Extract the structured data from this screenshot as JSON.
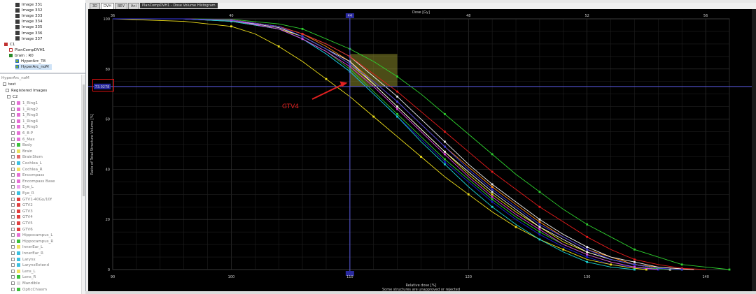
{
  "top_tree": [
    {
      "label": "Image 331",
      "icon": "image-icon",
      "indent": 22
    },
    {
      "label": "Image 332",
      "icon": "image-icon",
      "indent": 22
    },
    {
      "label": "Image 333",
      "icon": "image-icon",
      "indent": 22
    },
    {
      "label": "Image 334",
      "icon": "image-icon",
      "indent": 22
    },
    {
      "label": "Image 335",
      "icon": "image-icon",
      "indent": 22
    },
    {
      "label": "Image 336",
      "icon": "image-icon",
      "indent": 22
    },
    {
      "label": "Image 337",
      "icon": "image-icon",
      "indent": 22
    },
    {
      "label": "C1",
      "icon": "course-icon",
      "indent": 6
    },
    {
      "label": "PlanCompDVH1",
      "icon": "plan-sum-icon",
      "indent": 13
    },
    {
      "label": "brain : R0",
      "icon": "structure-set-icon",
      "indent": 13
    },
    {
      "label": "HyperArc_T8",
      "icon": "plan-icon",
      "indent": 22
    },
    {
      "label": "HyperArc_noM",
      "icon": "plan-icon",
      "indent": 22
    }
  ],
  "struct_header": {
    "title": "HyperArc_noM",
    "patient": "test",
    "registered": "Registered Images",
    "course": "C2"
  },
  "structures": [
    {
      "label": "1_Ring1",
      "color": "#e66fd6"
    },
    {
      "label": "1_Ring2",
      "color": "#e66fd6"
    },
    {
      "label": "1_Ring3",
      "color": "#e66fd6"
    },
    {
      "label": "1_Ring4",
      "color": "#e66fd6"
    },
    {
      "label": "1_Ring5",
      "color": "#e66fd6"
    },
    {
      "label": "6_8-P",
      "color": "#e66fd6"
    },
    {
      "label": "6_Max",
      "color": "#e66fd6"
    },
    {
      "label": "Body",
      "color": "#3cc03c"
    },
    {
      "label": "Brain",
      "color": "#e8e060"
    },
    {
      "label": "BrainStem",
      "color": "#e0686a"
    },
    {
      "label": "Cochlea_L",
      "color": "#3cc0e0"
    },
    {
      "label": "Cochlea_R",
      "color": "#f0e060"
    },
    {
      "label": "Encompass",
      "color": "#e66fd6"
    },
    {
      "label": "Encompass Base",
      "color": "#e66fd6"
    },
    {
      "label": "Eye_L",
      "color": "#f0a0f0"
    },
    {
      "label": "Eye_R",
      "color": "#3cc0e0"
    },
    {
      "label": "GTV1-40Gy/10f",
      "color": "#e04040"
    },
    {
      "label": "GTV2",
      "color": "#e04040"
    },
    {
      "label": "GTV3",
      "color": "#e04040"
    },
    {
      "label": "GTV4",
      "color": "#e04040"
    },
    {
      "label": "GTV5",
      "color": "#e04040"
    },
    {
      "label": "GTV6",
      "color": "#e04040"
    },
    {
      "label": "Hippocampus_L",
      "color": "#e66fd6"
    },
    {
      "label": "Hippocampus_R",
      "color": "#3cc03c"
    },
    {
      "label": "InnerEar_L",
      "color": "#f0e060"
    },
    {
      "label": "InnerEar_R",
      "color": "#3cc0e0"
    },
    {
      "label": "Larynx",
      "color": "#3cc0e0"
    },
    {
      "label": "LarynxExtend",
      "color": "#3cc0e0"
    },
    {
      "label": "Lens_L",
      "color": "#f0e060"
    },
    {
      "label": "Lens_R",
      "color": "#3cc03c"
    },
    {
      "label": "Mandible",
      "color": "#dddddd"
    },
    {
      "label": "OpticChiasm",
      "color": "#3cc03c"
    }
  ],
  "tabs": [
    "3D",
    "DVH",
    "BEV",
    "Ani"
  ],
  "active_tab": "DVH",
  "plot_title": "PlanCompDVH1 - Dose Volume Histogram",
  "readout": "73.0278",
  "annotation": "GTV4",
  "footer_note": "Some structures are unapproved or rejected",
  "chart_data": {
    "type": "line",
    "title": "",
    "xlabel": "Relative dose [%]",
    "x2label": "Dose [Gy]",
    "ylabel": "Ratio of Total Structure Volume [%]",
    "xlim": [
      90,
      142
    ],
    "ylim": [
      0,
      100
    ],
    "xticks": [
      "90",
      "100",
      "110",
      "120",
      "130",
      "140"
    ],
    "x2ticks": [
      "36",
      "40",
      "44",
      "48",
      "52",
      "56"
    ],
    "yticks": [
      "0",
      "20",
      "40",
      "60",
      "80",
      "100"
    ],
    "cursor_x": "110",
    "cursor_x2": "44",
    "cursor_y": 73.0278,
    "grid": true,
    "series": [
      {
        "color": "#1d1dd0",
        "x": [
          90,
          96,
          100,
          104,
          106,
          108,
          110,
          112,
          114,
          116,
          118,
          120,
          122,
          124,
          126,
          128,
          130,
          132,
          134,
          135,
          136
        ],
        "y": [
          100,
          100,
          99,
          96,
          92,
          86,
          79,
          70,
          61,
          52,
          43,
          35,
          27,
          20,
          14,
          9,
          5,
          2,
          1,
          0.3,
          0
        ]
      },
      {
        "color": "#f2e21a",
        "x": [
          90,
          96,
          100,
          102,
          104,
          106,
          108,
          110,
          112,
          114,
          116,
          118,
          120,
          122,
          124,
          126,
          128,
          130,
          132,
          134,
          135
        ],
        "y": [
          100,
          99,
          97,
          94,
          89,
          83,
          76,
          69,
          61,
          53,
          45,
          37,
          30,
          23,
          17,
          12,
          8,
          4,
          2,
          0.5,
          0
        ]
      },
      {
        "color": "#f2e21a",
        "x": [
          90,
          96,
          100,
          104,
          106,
          108,
          110,
          112,
          114,
          116,
          118,
          120,
          122,
          124,
          126,
          128,
          130,
          132,
          134,
          136,
          137
        ],
        "y": [
          100,
          100,
          99,
          96,
          93,
          88,
          82,
          74,
          65,
          56,
          47,
          38,
          30,
          23,
          17,
          11,
          7,
          4,
          2,
          0.5,
          0
        ]
      },
      {
        "color": "#ff8c1a",
        "x": [
          90,
          96,
          100,
          104,
          106,
          108,
          110,
          112,
          114,
          116,
          118,
          120,
          122,
          124,
          126,
          128,
          130,
          132,
          134,
          136,
          138,
          139
        ],
        "y": [
          100,
          100,
          99.5,
          97,
          94,
          89,
          83,
          75,
          67,
          58,
          49,
          41,
          33,
          26,
          19,
          13,
          8,
          5,
          2,
          1,
          0.2,
          0
        ]
      },
      {
        "color": "#f0f0f0",
        "x": [
          90,
          96,
          100,
          104,
          106,
          108,
          110,
          112,
          114,
          116,
          118,
          120,
          122,
          124,
          126,
          128,
          130,
          132,
          134,
          136,
          138,
          139
        ],
        "y": [
          100,
          100,
          99.6,
          97,
          94,
          90,
          85,
          77,
          69,
          60,
          51,
          42,
          34,
          27,
          20,
          14,
          9,
          5,
          3,
          1,
          0.3,
          0
        ]
      },
      {
        "color": "#f0f0f0",
        "x": [
          90,
          96,
          100,
          104,
          106,
          108,
          110,
          112,
          114,
          116,
          118,
          120,
          122,
          124,
          126,
          128,
          130,
          132,
          134,
          136,
          137
        ],
        "y": [
          100,
          100,
          99.5,
          96.5,
          93,
          88,
          83,
          74,
          65,
          56,
          47,
          39,
          31,
          24,
          17,
          12,
          7,
          4,
          2,
          0.5,
          0
        ]
      },
      {
        "color": "#2ed02e",
        "x": [
          90,
          96,
          100,
          104,
          106,
          108,
          110,
          112,
          114,
          116,
          118,
          120,
          122,
          124,
          126,
          128,
          130,
          132,
          134,
          136,
          138
        ],
        "y": [
          100,
          100,
          99.2,
          96,
          92,
          87,
          80,
          71,
          62,
          53,
          44,
          36,
          28,
          21,
          15,
          10,
          6,
          3,
          1,
          0.3,
          0
        ]
      },
      {
        "color": "#2ed02e",
        "x": [
          90,
          96,
          100,
          104,
          106,
          108,
          110,
          112,
          114,
          116,
          118,
          120,
          122,
          124,
          126,
          128,
          130,
          132,
          134,
          136,
          138,
          140,
          142
        ],
        "y": [
          100,
          100,
          99.8,
          98,
          96,
          92,
          88,
          83,
          77,
          70,
          62,
          54,
          46,
          38,
          31,
          24,
          18,
          13,
          8,
          5,
          2,
          1,
          0
        ]
      },
      {
        "color": "#e51b1b",
        "x": [
          90,
          96,
          100,
          104,
          106,
          108,
          110,
          112,
          114,
          116,
          118,
          120,
          122,
          124,
          126,
          128,
          130,
          132,
          134,
          136,
          138,
          140
        ],
        "y": [
          100,
          100,
          99.6,
          97,
          94,
          90,
          85,
          78,
          71,
          63,
          55,
          47,
          39,
          32,
          25,
          19,
          13,
          8,
          4,
          2,
          0.5,
          0
        ]
      },
      {
        "color": "#19d6d6",
        "x": [
          90,
          96,
          100,
          104,
          106,
          108,
          110,
          112,
          114,
          116,
          118,
          120,
          122,
          124,
          126,
          128,
          130,
          132,
          134
        ],
        "y": [
          100,
          100,
          99,
          96,
          92,
          86,
          79,
          70,
          61,
          51,
          42,
          33,
          25,
          18,
          12,
          7,
          3,
          1,
          0
        ]
      },
      {
        "color": "#e040e0",
        "x": [
          90,
          96,
          100,
          104,
          106,
          108,
          110,
          112,
          114,
          116,
          118,
          120,
          122,
          124,
          126,
          128,
          130,
          132,
          134,
          136
        ],
        "y": [
          100,
          100,
          99.4,
          96,
          92,
          87,
          81,
          73,
          64,
          55,
          46,
          37,
          29,
          22,
          16,
          10,
          6,
          3,
          1,
          0
        ]
      },
      {
        "color": "#3a3ae6",
        "x": [
          90,
          96,
          100,
          104,
          106,
          108,
          110,
          112,
          114,
          116,
          118,
          120,
          122,
          124,
          126,
          128,
          130,
          132,
          134,
          136,
          138
        ],
        "y": [
          100,
          100,
          99.5,
          97,
          93,
          88,
          82,
          75,
          67,
          58,
          49,
          40,
          32,
          25,
          18,
          13,
          8,
          4,
          2,
          0.5,
          0
        ]
      }
    ]
  }
}
